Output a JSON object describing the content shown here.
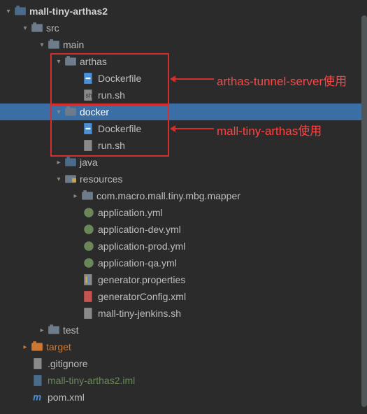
{
  "tree": {
    "root": "mall-tiny-arthas2",
    "src": "src",
    "main": "main",
    "arthas": "arthas",
    "arthas_dockerfile": "Dockerfile",
    "arthas_runsh": "run.sh",
    "docker": "docker",
    "docker_dockerfile": "Dockerfile",
    "docker_runsh": "run.sh",
    "java": "java",
    "resources": "resources",
    "pkg": "com.macro.mall.tiny.mbg.mapper",
    "app_yml": "application.yml",
    "app_dev": "application-dev.yml",
    "app_prod": "application-prod.yml",
    "app_qa": "application-qa.yml",
    "gen_props": "generator.properties",
    "gen_config": "generatorConfig.xml",
    "jenkins_sh": "mall-tiny-jenkins.sh",
    "test": "test",
    "target": "target",
    "gitignore": ".gitignore",
    "iml": "mall-tiny-arthas2.iml",
    "pom": "pom.xml"
  },
  "annotations": {
    "arthas_note": "arthas-tunnel-server使用",
    "docker_note": "mall-tiny-arthas使用"
  },
  "colors": {
    "bg": "#2b2b2b",
    "selection": "#3a6ea5",
    "orange": "#cc7832",
    "green": "#6a8759",
    "box": "#d32f2f"
  }
}
